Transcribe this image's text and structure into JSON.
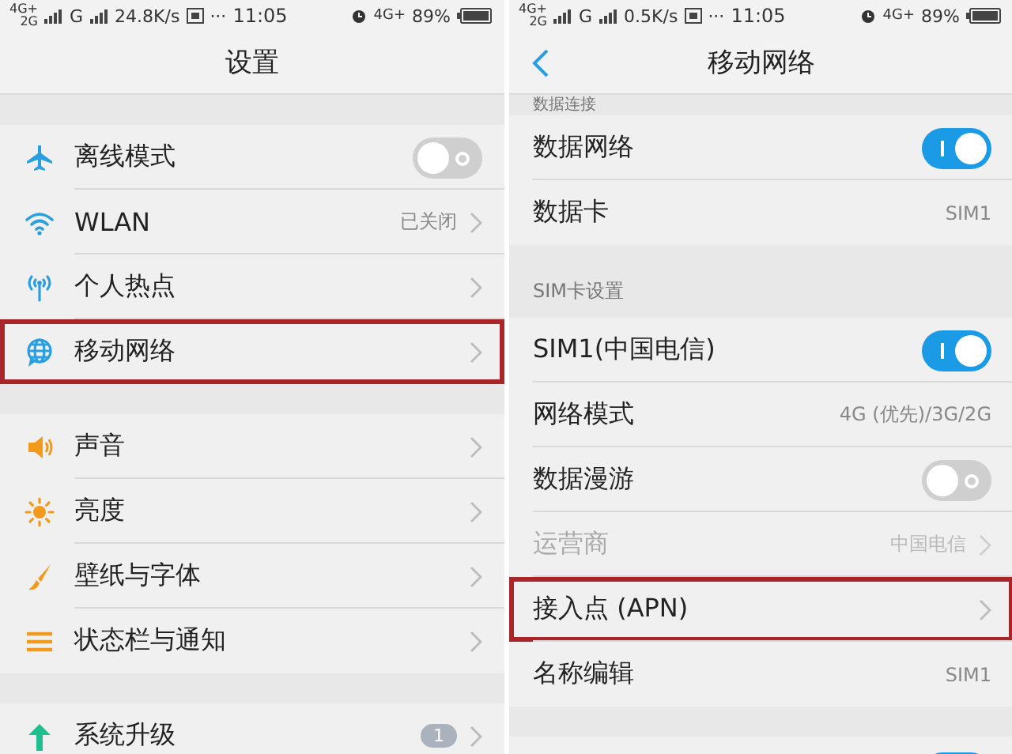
{
  "screens": [
    {
      "status_bar": {
        "network_top": "4G+",
        "network_bottom": "2G",
        "network_2": "G",
        "speed": "24.8K/s",
        "dots": "···",
        "time": "11:05",
        "network_right": "4G+",
        "battery": "89%"
      },
      "title": "设置",
      "back": false,
      "sections": [
        {
          "items": [
            {
              "kind": "toggle",
              "label": "离线模式",
              "on": false,
              "highlighted": false
            },
            {
              "kind": "link",
              "label": "WLAN",
              "value": "已关闭",
              "highlighted": false
            },
            {
              "kind": "link",
              "label": "个人热点",
              "highlighted": false
            },
            {
              "kind": "link",
              "label": "移动网络",
              "highlighted": true
            }
          ]
        },
        {
          "items": [
            {
              "kind": "link",
              "label": "声音",
              "highlighted": false
            },
            {
              "kind": "link",
              "label": "亮度",
              "highlighted": false
            },
            {
              "kind": "link",
              "label": "壁纸与字体",
              "highlighted": false
            },
            {
              "kind": "link",
              "label": "状态栏与通知",
              "highlighted": false
            }
          ]
        },
        {
          "items": [
            {
              "kind": "link",
              "label": "系统升级",
              "badge": "1",
              "highlighted": false
            }
          ]
        }
      ]
    },
    {
      "status_bar": {
        "network_top": "4G+",
        "network_bottom": "2G",
        "network_2": "G",
        "speed": "0.5K/s",
        "dots": "···",
        "time": "11:05",
        "network_right": "4G+",
        "battery": "89%"
      },
      "title": "移动网络",
      "back": true,
      "sections": [
        {
          "header": "数据连接",
          "items": [
            {
              "kind": "toggle",
              "label": "数据网络",
              "on": true,
              "highlighted": false
            },
            {
              "kind": "value",
              "label": "数据卡",
              "value": "SIM1",
              "highlighted": false
            }
          ]
        },
        {
          "header": "SIM卡设置",
          "items": [
            {
              "kind": "toggle",
              "label": "SIM1(中国电信)",
              "on": true,
              "highlighted": false
            },
            {
              "kind": "value",
              "label": "网络模式",
              "value": "4G (优先)/3G/2G",
              "highlighted": false
            },
            {
              "kind": "toggle",
              "label": "数据漫游",
              "on": false,
              "highlighted": false
            },
            {
              "kind": "link",
              "label": "运营商",
              "value": "中国电信",
              "disabled": true,
              "highlighted": false
            },
            {
              "kind": "link",
              "label": "接入点 (APN)",
              "highlighted": true
            },
            {
              "kind": "value",
              "label": "名称编辑",
              "value": "SIM1",
              "highlighted": false
            }
          ]
        },
        {
          "items": [
            {
              "kind": "toggle",
              "on": true,
              "highlighted": false
            }
          ]
        }
      ]
    }
  ]
}
